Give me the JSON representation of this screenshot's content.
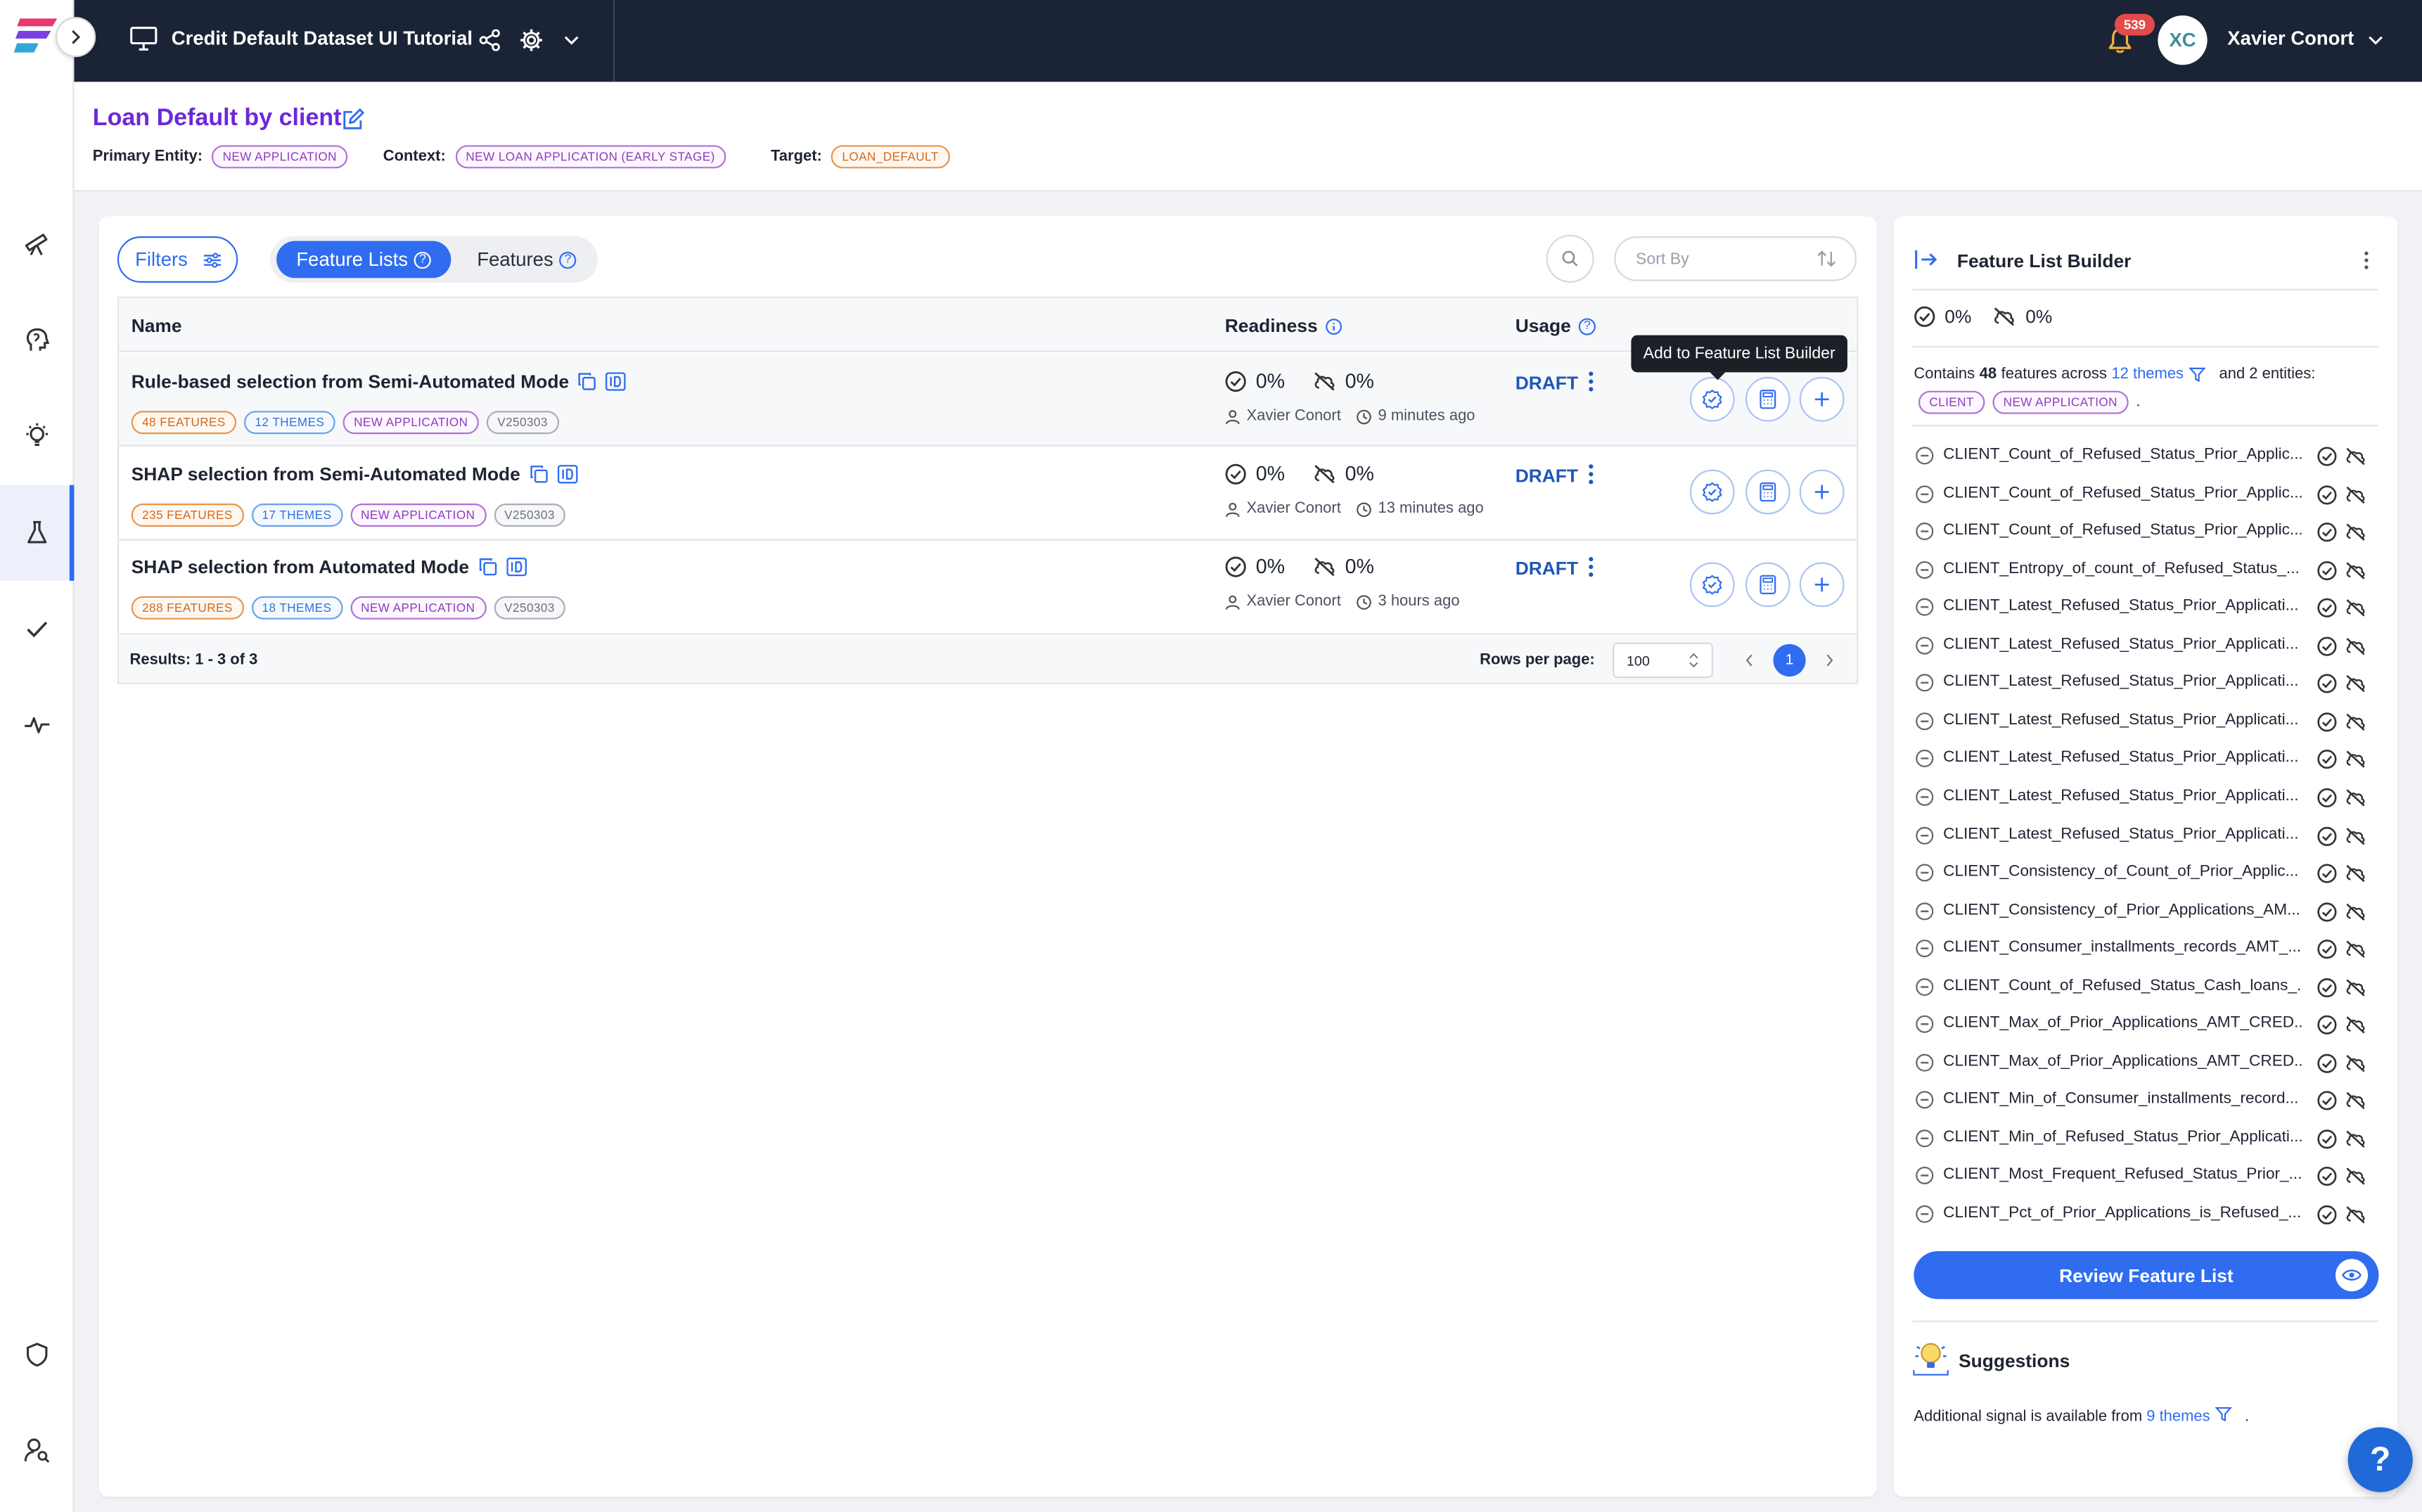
{
  "topbar": {
    "title": "Credit Default Dataset UI Tutorial",
    "notifications": "539",
    "user_initials": "XC",
    "user_name": "Xavier Conort"
  },
  "header": {
    "title": "Loan Default by client",
    "primary_entity_label": "Primary Entity:",
    "primary_entity": "NEW APPLICATION",
    "context_label": "Context:",
    "context": "NEW LOAN APPLICATION (EARLY STAGE)",
    "target_label": "Target:",
    "target": "LOAN_DEFAULT"
  },
  "toolbar": {
    "filters": "Filters",
    "tab_feature_lists": "Feature Lists",
    "tab_features": "Features",
    "sort_placeholder": "Sort By"
  },
  "table": {
    "columns": [
      "Name",
      "Readiness",
      "Usage"
    ],
    "rows": [
      {
        "name": "Rule-based selection from Semi-Automated Mode",
        "features": "48 FEATURES",
        "themes": "12 THEMES",
        "entity": "NEW APPLICATION",
        "version": "V250303",
        "ready": "0%",
        "online": "0%",
        "owner": "Xavier Conort",
        "time": "9 minutes ago",
        "status": "DRAFT"
      },
      {
        "name": "SHAP selection from Semi-Automated Mode",
        "features": "235 FEATURES",
        "themes": "17 THEMES",
        "entity": "NEW APPLICATION",
        "version": "V250303",
        "ready": "0%",
        "online": "0%",
        "owner": "Xavier Conort",
        "time": "13 minutes ago",
        "status": "DRAFT"
      },
      {
        "name": "SHAP selection from Automated Mode",
        "features": "288 FEATURES",
        "themes": "18 THEMES",
        "entity": "NEW APPLICATION",
        "version": "V250303",
        "ready": "0%",
        "online": "0%",
        "owner": "Xavier Conort",
        "time": "3 hours ago",
        "status": "DRAFT"
      }
    ],
    "results": "Results: 1 - 3 of 3",
    "rows_per_page_label": "Rows per page:",
    "rows_per_page": "100",
    "current_page": "1",
    "tooltip": "Add to Feature List Builder"
  },
  "builder": {
    "title": "Feature List Builder",
    "ready": "0%",
    "online": "0%",
    "contains_prefix": "Contains",
    "feature_count": "48",
    "contains_mid": "features across",
    "themes_link": "12 themes",
    "contains_suffix": "and 2 entities:",
    "entities": [
      "CLIENT",
      "NEW APPLICATION"
    ],
    "entities_dot": ".",
    "features": [
      "CLIENT_Count_of_Refused_Status_Prior_Applic...",
      "CLIENT_Count_of_Refused_Status_Prior_Applic...",
      "CLIENT_Count_of_Refused_Status_Prior_Applic...",
      "CLIENT_Entropy_of_count_of_Refused_Status_...",
      "CLIENT_Latest_Refused_Status_Prior_Applicati...",
      "CLIENT_Latest_Refused_Status_Prior_Applicati...",
      "CLIENT_Latest_Refused_Status_Prior_Applicati...",
      "CLIENT_Latest_Refused_Status_Prior_Applicati...",
      "CLIENT_Latest_Refused_Status_Prior_Applicati...",
      "CLIENT_Latest_Refused_Status_Prior_Applicati...",
      "CLIENT_Latest_Refused_Status_Prior_Applicati...",
      "CLIENT_Consistency_of_Count_of_Prior_Applic...",
      "CLIENT_Consistency_of_Prior_Applications_AM...",
      "CLIENT_Consumer_installments_records_AMT_...",
      "CLIENT_Count_of_Refused_Status_Cash_loans_...",
      "CLIENT_Max_of_Prior_Applications_AMT_CRED...",
      "CLIENT_Max_of_Prior_Applications_AMT_CRED...",
      "CLIENT_Min_of_Consumer_installments_record...",
      "CLIENT_Min_of_Refused_Status_Prior_Applicati...",
      "CLIENT_Most_Frequent_Refused_Status_Prior_...",
      "CLIENT_Pct_of_Prior_Applications_is_Refused_..."
    ],
    "review_button": "Review Feature List",
    "suggestions_title": "Suggestions",
    "suggestion_prefix": "Additional signal is available from",
    "suggestion_link": "9 themes",
    "suggestion_suffix": "."
  },
  "help_label": "?"
}
